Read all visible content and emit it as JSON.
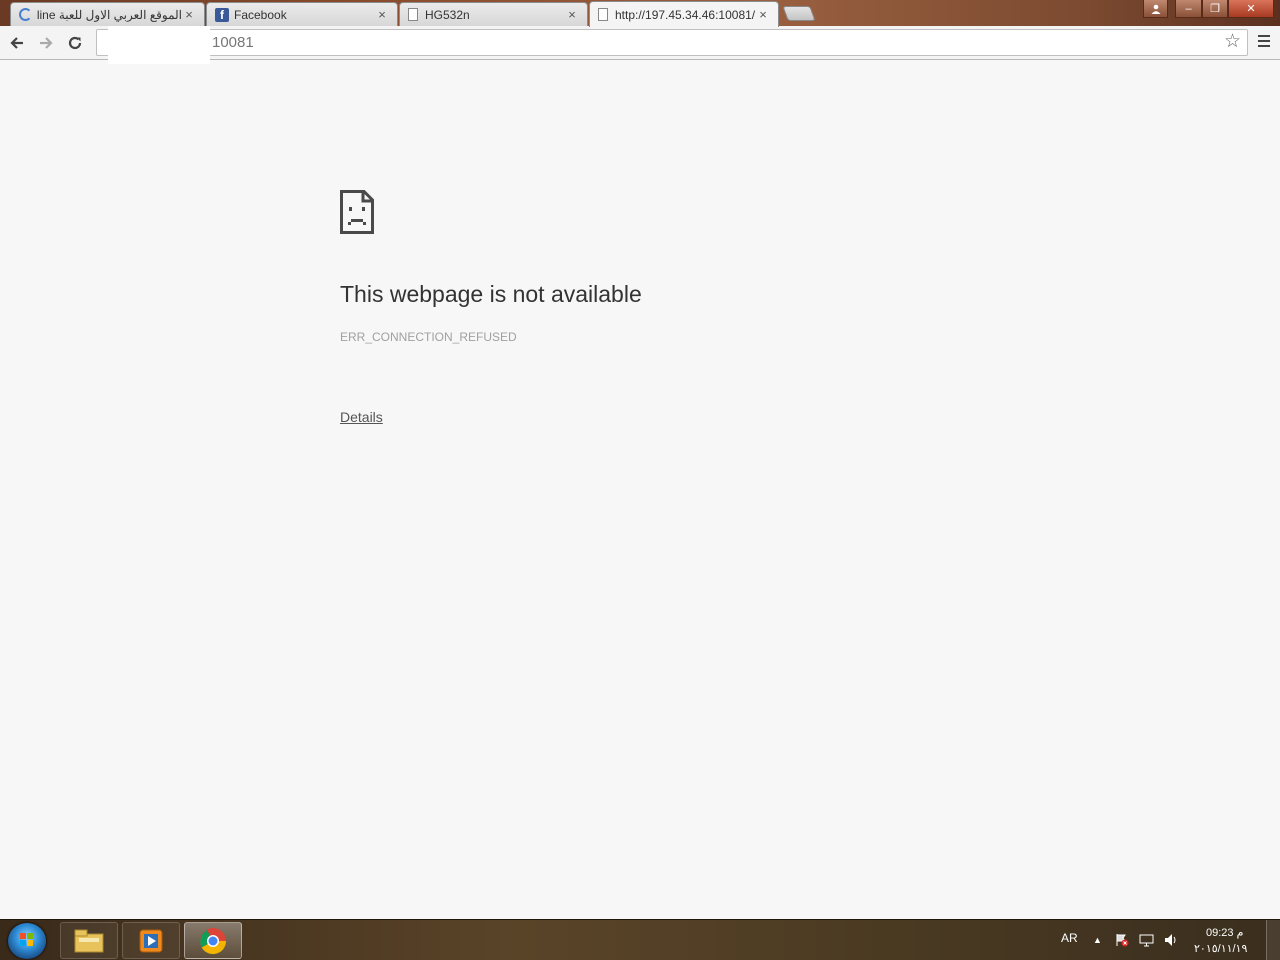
{
  "tabs": [
    {
      "label": "الموقع العربي الاول للعبة Online",
      "icon": "loading-spinner-icon",
      "close": "×"
    },
    {
      "label": "Facebook",
      "icon": "facebook-icon",
      "icon_glyph": "f",
      "close": "×"
    },
    {
      "label": "HG532n",
      "icon": "page-icon",
      "close": "×"
    },
    {
      "label": "http://197.45.34.46:10081/",
      "icon": "page-icon",
      "close": "×",
      "active": true
    }
  ],
  "window_controls": {
    "user": "user-icon",
    "minimize": "–",
    "restore": "❐",
    "close": "✕"
  },
  "toolbar": {
    "back": "back-arrow-icon",
    "forward": "forward-arrow-icon",
    "reload": "reload-icon",
    "address_value": "10081",
    "bookmark": "star-icon",
    "menu": "hamburger-menu-icon"
  },
  "error_page": {
    "title": "This webpage is not available",
    "code": "ERR_CONNECTION_REFUSED",
    "details_link": "Details",
    "icon": "sad-document-icon"
  },
  "taskbar": {
    "start": "windows-start-icon",
    "apps": [
      {
        "name": "file-explorer-icon",
        "active": false
      },
      {
        "name": "media-player-icon",
        "active": false
      },
      {
        "name": "chrome-icon",
        "active": true
      }
    ],
    "language": "AR",
    "clock_time": "09:23 م",
    "clock_date": "٢٠١٥/١١/١٩"
  },
  "colors": {
    "page_background": "#f7f7f7",
    "title_text": "#333333",
    "error_code_text": "#a0a0a0",
    "facebook_blue": "#3b5998"
  }
}
